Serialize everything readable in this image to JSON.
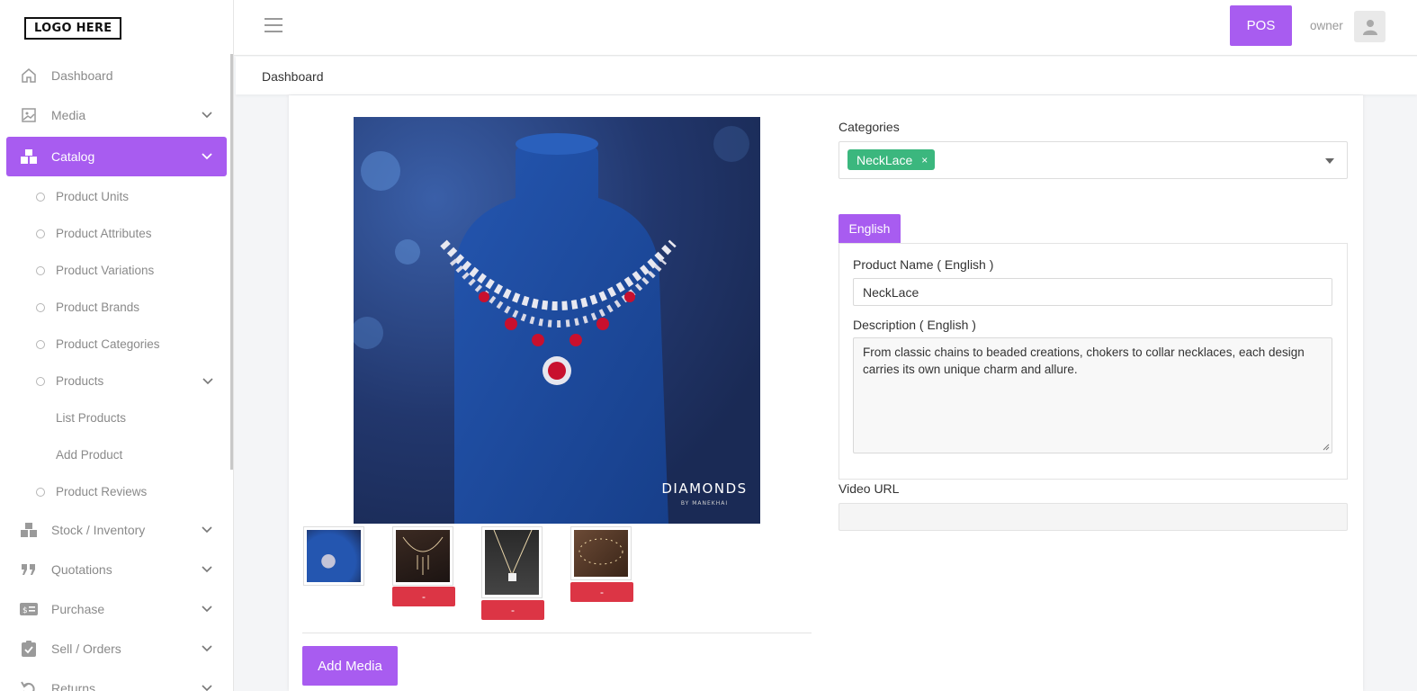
{
  "app": {
    "logo_text": "LOGO HERE"
  },
  "header": {
    "pos_label": "POS",
    "user_name": "owner"
  },
  "breadcrumb": {
    "current": "Dashboard"
  },
  "sidebar": {
    "items": [
      {
        "label": "Dashboard",
        "icon": "home-icon"
      },
      {
        "label": "Media",
        "icon": "image-icon"
      },
      {
        "label": "Catalog",
        "icon": "boxes-icon"
      },
      {
        "label": "Stock / Inventory",
        "icon": "boxes-icon"
      },
      {
        "label": "Quotations",
        "icon": "quote-icon"
      },
      {
        "label": "Purchase",
        "icon": "money-card-icon"
      },
      {
        "label": "Sell / Orders",
        "icon": "clipboard-check-icon"
      },
      {
        "label": "Returns",
        "icon": "undo-icon"
      }
    ],
    "catalog_sub": [
      {
        "label": "Product Units"
      },
      {
        "label": "Product Attributes"
      },
      {
        "label": "Product Variations"
      },
      {
        "label": "Product Brands"
      },
      {
        "label": "Product Categories"
      },
      {
        "label": "Products"
      },
      {
        "label": "Product Reviews"
      }
    ],
    "products_sub": [
      {
        "label": "List Products"
      },
      {
        "label": "Add Product"
      }
    ]
  },
  "media": {
    "main_image_caption": "DIAMONDS",
    "main_image_subcaption": "BY MANEKHAI",
    "remove_label": "-",
    "add_media_label": "Add Media"
  },
  "form": {
    "categories_label": "Categories",
    "categories_selected": "NeckLace",
    "chip_remove": "×",
    "language_tab": "English",
    "product_name_label": "Product Name ( English )",
    "product_name_value": "NeckLace",
    "description_label": "Description ( English )",
    "description_value": "From classic chains to beaded creations, chokers to collar necklaces, each design carries its own unique charm and allure.",
    "video_url_label": "Video URL",
    "video_url_value": ""
  },
  "colors": {
    "accent": "#a85cf0",
    "chip": "#3bb77e",
    "danger": "#dc3545"
  }
}
